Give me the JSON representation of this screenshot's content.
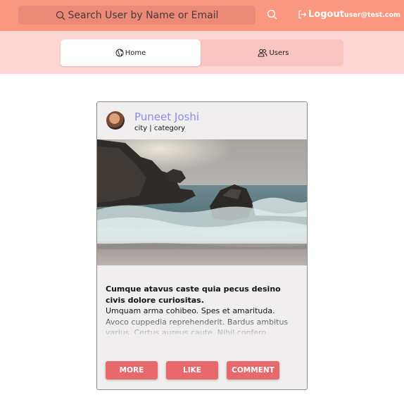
{
  "header": {
    "search_placeholder": "Search User by Name or Email",
    "logout_label": "Logout",
    "user_email": "user@test.com"
  },
  "nav": {
    "tabs": [
      {
        "label": "Home",
        "icon": "globe-icon",
        "active": true
      },
      {
        "label": "Users",
        "icon": "users-icon",
        "active": false
      }
    ]
  },
  "post": {
    "author": "Puneet Joshi",
    "meta": "city | category",
    "title": "Cumque atavus caste quia pecus desino civis dolore curiositas.",
    "body": "Umquam arma cohibeo. Spes et amarituda. Avoco cuppedia reprehenderit. Bardus ambitus varius. Certus aureus caute. Nihil confero.",
    "buttons": {
      "more": "MORE",
      "like": "LIKE",
      "comment": "COMMENT"
    }
  },
  "colors": {
    "header_bg": "#f9977f",
    "nav_bg": "#fdd6d4",
    "button_bg": "#e8696b",
    "author_color": "#8c8ee6"
  }
}
